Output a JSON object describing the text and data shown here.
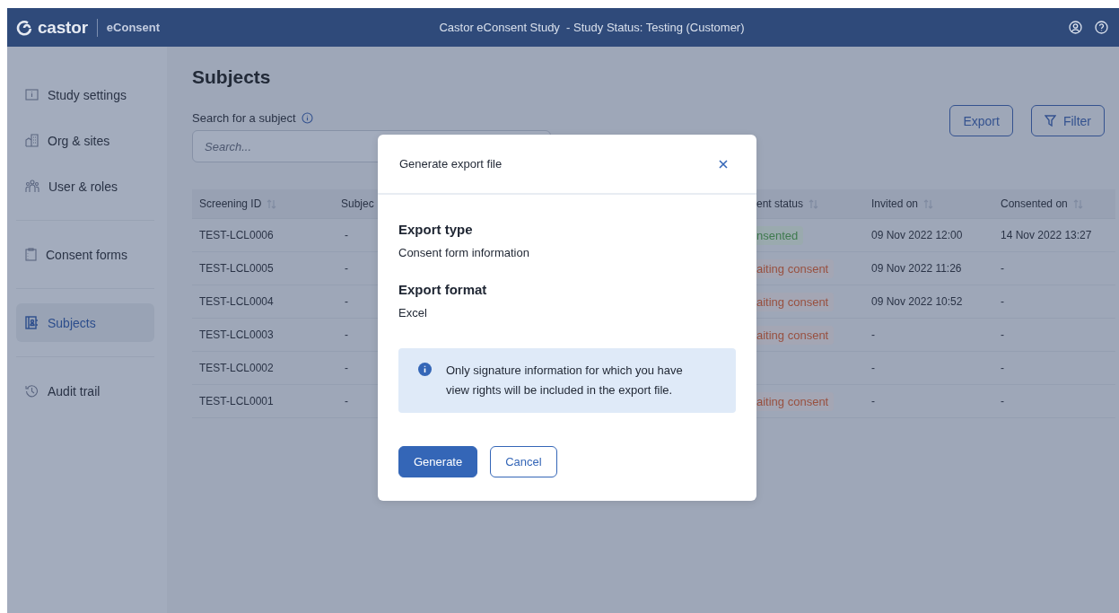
{
  "header": {
    "logo": "castor",
    "product": "eConsent",
    "title": "Castor eConsent Study  - Study Status: Testing (Customer)"
  },
  "sidebar": {
    "groups": [
      {
        "items": [
          {
            "label": "Study settings",
            "selected": false
          },
          {
            "label": "Org & sites",
            "selected": false
          },
          {
            "label": "User & roles",
            "selected": false
          }
        ]
      },
      {
        "items": [
          {
            "label": "Consent forms",
            "selected": false
          }
        ]
      },
      {
        "items": [
          {
            "label": "Subjects",
            "selected": true
          }
        ]
      },
      {
        "items": [
          {
            "label": "Audit trail",
            "selected": false
          }
        ]
      }
    ]
  },
  "page": {
    "title": "Subjects",
    "search_label": "Search for a subject",
    "search": {
      "placeholder": "Search..."
    },
    "buttons": [
      {
        "label": "Export",
        "kind": "plain"
      },
      {
        "label": "Filter",
        "kind": "filter"
      }
    ]
  },
  "table": {
    "columns": [
      {
        "label": "Screening ID",
        "sortable": true
      },
      {
        "label": "Subjec"
      },
      {
        "label": "ent status",
        "sortable": true
      },
      {
        "label": "Invited on",
        "sortable": true
      },
      {
        "label": "Consented on",
        "sortable": true
      }
    ],
    "rows": [
      {
        "screening_id": "TEST-LCL0006",
        "subject": "-",
        "status": {
          "text": "nsented",
          "kind": "consented"
        },
        "invited": "09 Nov 2022 12:00",
        "consented": "14 Nov 2022 13:27"
      },
      {
        "screening_id": "TEST-LCL0005",
        "subject": "-",
        "status": {
          "text": "aiting consent",
          "kind": "awaiting"
        },
        "invited": "09 Nov 2022 11:26",
        "consented": "-"
      },
      {
        "screening_id": "TEST-LCL0004",
        "subject": "-",
        "status": {
          "text": "aiting consent",
          "kind": "awaiting"
        },
        "invited": "09 Nov 2022 10:52",
        "consented": "-"
      },
      {
        "screening_id": "TEST-LCL0003",
        "subject": "-",
        "status": {
          "text": "aiting consent",
          "kind": "awaiting"
        },
        "invited": "-",
        "consented": "-"
      },
      {
        "screening_id": "TEST-LCL0002",
        "subject": "-",
        "invited": "-",
        "consented": "-"
      },
      {
        "screening_id": "TEST-LCL0001",
        "subject": "-",
        "status": {
          "text": "aiting consent",
          "kind": "awaiting"
        },
        "invited": "-",
        "consented": "-"
      }
    ]
  },
  "modal": {
    "title": "Generate export file",
    "sections": [
      {
        "heading": "Export type",
        "value": "Consent form information"
      },
      {
        "heading": "Export format",
        "value": "Excel"
      }
    ],
    "notice": "Only signature information for which you have view rights will be included in the export file.",
    "buttons": [
      {
        "label": "Generate",
        "kind": "primary"
      },
      {
        "label": "Cancel",
        "kind": "secondary"
      }
    ]
  }
}
